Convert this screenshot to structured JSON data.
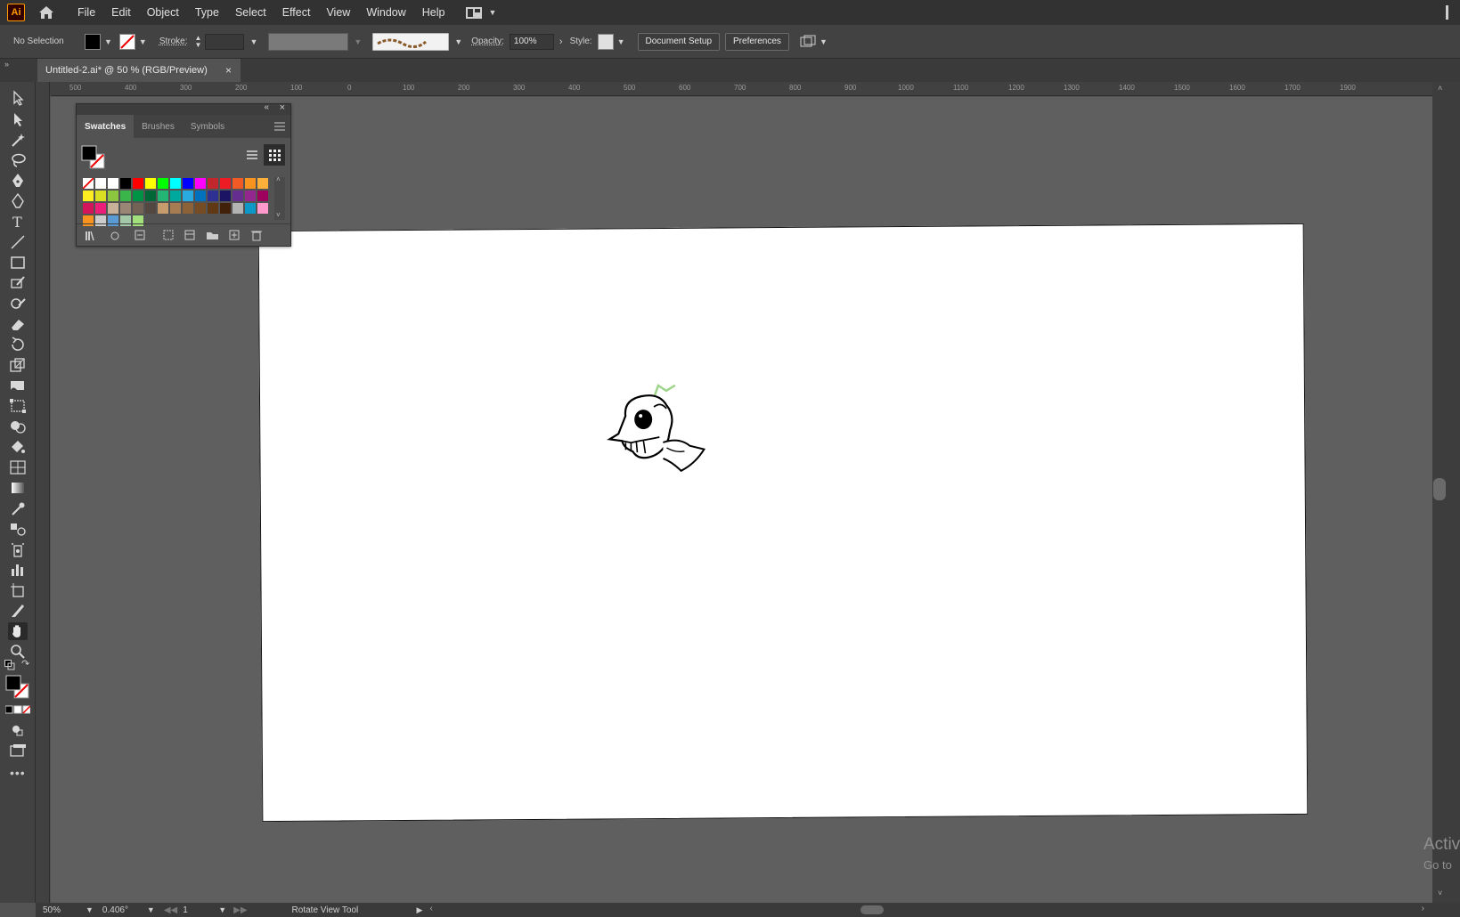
{
  "app": {
    "logo": "Ai"
  },
  "menu": [
    "File",
    "Edit",
    "Object",
    "Type",
    "Select",
    "Effect",
    "View",
    "Window",
    "Help"
  ],
  "control_bar": {
    "selection": "No Selection",
    "stroke_label": "Stroke:",
    "opacity_label": "Opacity:",
    "opacity_value": "100%",
    "style_label": "Style:",
    "document_setup": "Document Setup",
    "preferences": "Preferences"
  },
  "document_tab": {
    "title": "Untitled-2.ai* @ 50 % (RGB/Preview)",
    "close": "×"
  },
  "ruler_ticks": [
    "500",
    "400",
    "300",
    "200",
    "100",
    "0",
    "100",
    "200",
    "300",
    "400",
    "500",
    "600",
    "700",
    "800",
    "900",
    "1000",
    "1100",
    "1200",
    "1300",
    "1400",
    "1500",
    "1600",
    "1700",
    "1900"
  ],
  "swatches_panel": {
    "tabs": [
      "Swatches",
      "Brushes",
      "Symbols"
    ],
    "active_tab": "Swatches",
    "colors": [
      "#ffffff",
      "#ffffff",
      "#ffffff",
      "#000000",
      "#ff0000",
      "#ffff00",
      "#00ff00",
      "#00ffff",
      "#0000ff",
      "#ff00ff",
      "#c1272d",
      "#ed1c24",
      "#f15a24",
      "#f7931e",
      "#fbb03b",
      "#fcee21",
      "#d9e021",
      "#8cc63f",
      "#39b54a",
      "#009245",
      "#006837",
      "#22b573",
      "#00a99d",
      "#29abe2",
      "#0071bc",
      "#2e3192",
      "#1b1464",
      "#662d91",
      "#93278f",
      "#9e005d",
      "#d4145a",
      "#ed1e79",
      "#c7b299",
      "#998675",
      "#736357",
      "#534741",
      "#c69c6d",
      "#a67c52",
      "#8c6239",
      "#754c24",
      "#603813",
      "#42210b",
      "#b3b3b3",
      "#0d98c8",
      "#ff99cc",
      "#f7931e",
      "#cccccc",
      "#5b9bd5",
      "#a3c9a8",
      "#a1e07a"
    ]
  },
  "status_bar": {
    "zoom": "50%",
    "rotation": "0.406°",
    "artboard": "1",
    "tool": "Rotate View Tool"
  },
  "watermark": {
    "line1": "Activ",
    "line2": "Go to"
  }
}
